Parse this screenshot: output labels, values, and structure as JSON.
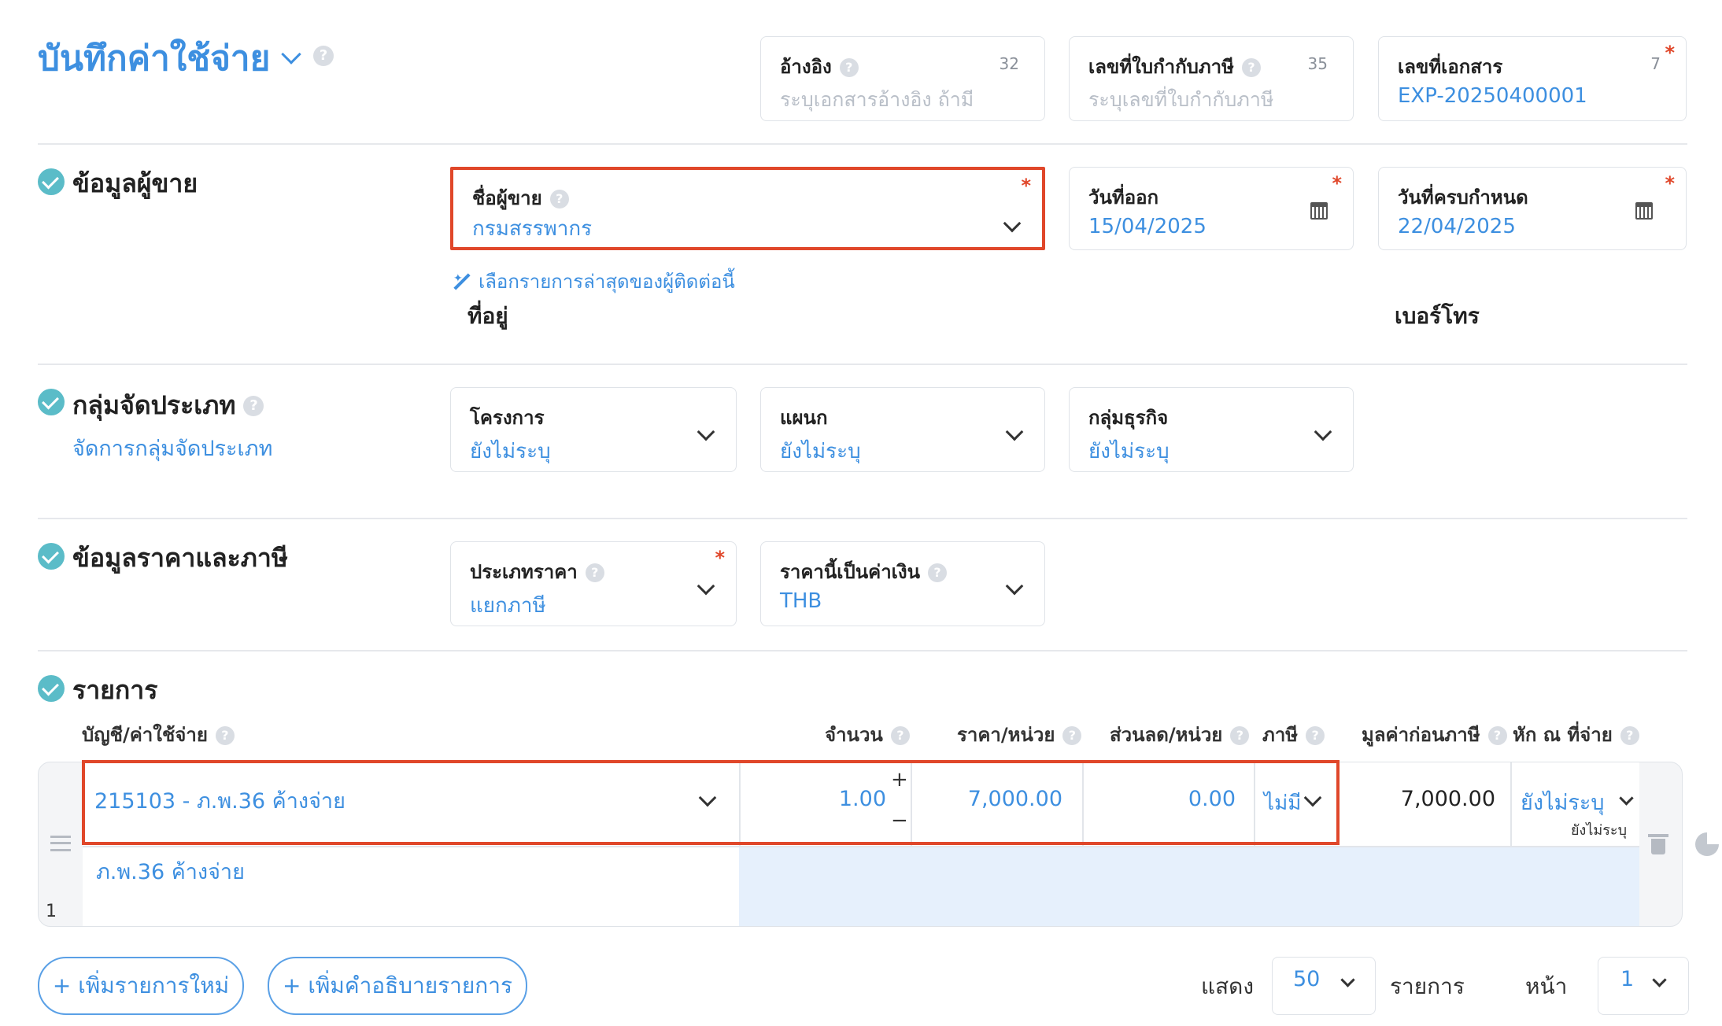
{
  "page": {
    "title": "บันทึกค่าใช้จ่าย",
    "help": "?"
  },
  "header_fields": {
    "reference": {
      "label": "อ้างอิง",
      "placeholder": "ระบุเอกสารอ้างอิง ถ้ามี",
      "count": "32"
    },
    "tax_invoice": {
      "label": "เลขที่ใบกำกับภาษี",
      "placeholder": "ระบุเลขที่ใบกำกับภาษี",
      "count": "35"
    },
    "document_no": {
      "label": "เลขที่เอกสาร",
      "value": "EXP-20250400001",
      "count": "7",
      "required": "*"
    }
  },
  "vendor_section": {
    "title": "ข้อมูลผู้ขาย",
    "vendor_name": {
      "label": "ชื่อผู้ขาย",
      "value": "กรมสรรพากร",
      "required": "*"
    },
    "issue_date": {
      "label": "วันที่ออก",
      "value": "15/04/2025",
      "required": "*"
    },
    "due_date": {
      "label": "วันที่ครบกำหนด",
      "value": "22/04/2025",
      "required": "*"
    },
    "recent_link": "เลือกรายการล่าสุดของผู้ติดต่อนี้",
    "address_label": "ที่อยู่",
    "phone_label": "เบอร์โทร"
  },
  "classification_section": {
    "title": "กลุ่มจัดประเภท",
    "manage_link": "จัดการกลุ่มจัดประเภท",
    "project": {
      "label": "โครงการ",
      "value": "ยังไม่ระบุ"
    },
    "department": {
      "label": "แผนก",
      "value": "ยังไม่ระบุ"
    },
    "business_group": {
      "label": "กลุ่มธุรกิจ",
      "value": "ยังไม่ระบุ"
    }
  },
  "price_section": {
    "title": "ข้อมูลราคาและภาษี",
    "price_type": {
      "label": "ประเภทราคา",
      "value": "แยกภาษี",
      "required": "*"
    },
    "currency": {
      "label": "ราคานี้เป็นค่าเงิน",
      "value": "THB"
    }
  },
  "items_section": {
    "title": "รายการ",
    "columns": {
      "account": "บัญชี/ค่าใช้จ่าย",
      "qty": "จำนวน",
      "unit_price": "ราคา/หน่วย",
      "discount": "ส่วนลด/หน่วย",
      "tax": "ภาษี",
      "pre_tax": "มูลค่าก่อนภาษี",
      "wht": "หัก ณ ที่จ่าย"
    },
    "rows": [
      {
        "index": "1",
        "account": "215103 - ภ.พ.36 ค้างจ่าย",
        "description": "ภ.พ.36 ค้างจ่าย",
        "qty": "1.00",
        "plus": "+",
        "minus": "−",
        "unit_price": "7,000.00",
        "discount": "0.00",
        "tax": "ไม่มี",
        "pre_tax": "7,000.00",
        "wht": "ยังไม่ระบุ",
        "wht_sub": "ยังไม่ระบุ"
      }
    ]
  },
  "footer": {
    "add_item": "+ เพิ่มรายการใหม่",
    "add_desc": "+ เพิ่มคำอธิบายรายการ",
    "show_label": "แสดง",
    "page_size": "50",
    "items_label": "รายการ",
    "page_label": "หน้า",
    "page_no": "1"
  },
  "colors": {
    "accent": "#3d8fe0",
    "highlight": "#e0472a",
    "check": "#5bbcc8",
    "row_fill": "#e6f0fc"
  }
}
